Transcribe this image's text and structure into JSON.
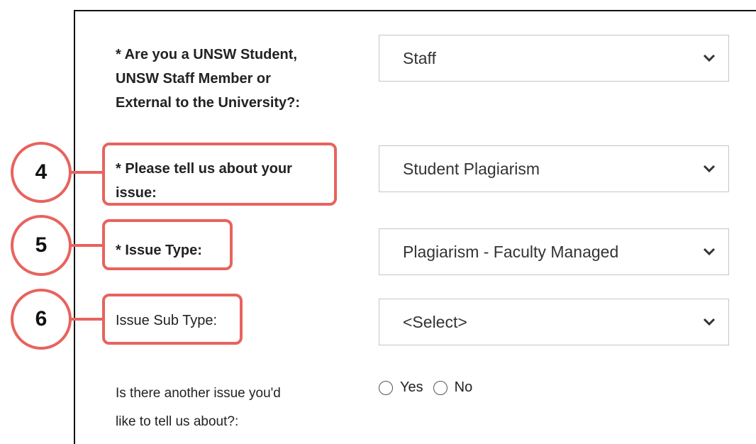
{
  "form": {
    "q1": {
      "label_lines": [
        "* Are you a UNSW Student,",
        "UNSW Staff Member or",
        "External to the University?:"
      ],
      "selected": "Staff"
    },
    "q2": {
      "label_lines": [
        "* Please tell us about your",
        "issue:"
      ],
      "selected": "Student Plagiarism"
    },
    "q3": {
      "label": "* Issue Type:",
      "selected": "Plagiarism - Faculty Managed"
    },
    "q4": {
      "label": "Issue Sub Type:",
      "selected": "<Select>"
    },
    "q5": {
      "label_lines": [
        "Is there another issue you'd",
        "like to tell us about?:"
      ],
      "options": [
        "Yes",
        "No"
      ]
    }
  },
  "annotations": {
    "step4": "4",
    "step5": "5",
    "step6": "6",
    "color": "#e8635e"
  },
  "icons": {
    "dropdown": "chevron-down-icon",
    "radio": "radio-unchecked-icon"
  }
}
